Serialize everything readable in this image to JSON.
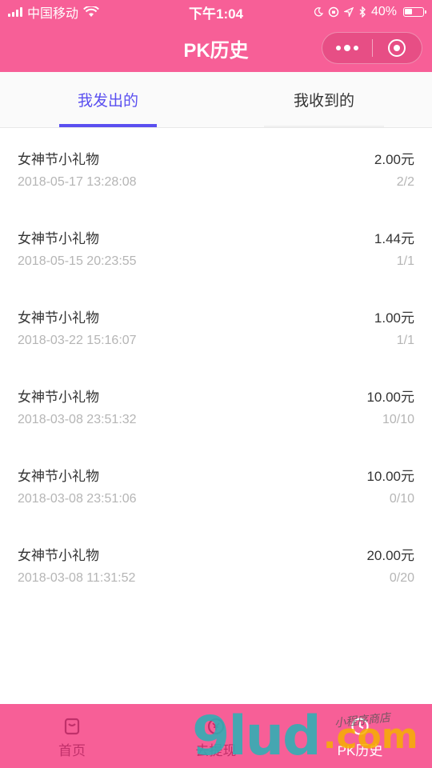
{
  "status_bar": {
    "carrier": "中国移动",
    "time": "下午1:04",
    "battery": "40%"
  },
  "nav": {
    "title": "PK历史"
  },
  "tabs": [
    {
      "label": "我发出的",
      "active": true
    },
    {
      "label": "我收到的",
      "active": false
    }
  ],
  "records": [
    {
      "name": "女神节小礼物",
      "amount": "2.00元",
      "time": "2018-05-17 13:28:08",
      "progress": "2/2"
    },
    {
      "name": "女神节小礼物",
      "amount": "1.44元",
      "time": "2018-05-15 20:23:55",
      "progress": "1/1"
    },
    {
      "name": "女神节小礼物",
      "amount": "1.00元",
      "time": "2018-03-22 15:16:07",
      "progress": "1/1"
    },
    {
      "name": "女神节小礼物",
      "amount": "10.00元",
      "time": "2018-03-08 23:51:32",
      "progress": "10/10"
    },
    {
      "name": "女神节小礼物",
      "amount": "10.00元",
      "time": "2018-03-08 23:51:06",
      "progress": "0/10"
    },
    {
      "name": "女神节小礼物",
      "amount": "20.00元",
      "time": "2018-03-08 11:31:52",
      "progress": "0/20"
    }
  ],
  "tab_bar": [
    {
      "label": "首页",
      "icon": "home-bag-icon",
      "active": false
    },
    {
      "label": "去提现",
      "icon": "withdraw-icon",
      "active": false
    },
    {
      "label": "PK历史",
      "icon": "clock-icon",
      "active": true
    }
  ],
  "watermark": {
    "text": "9lud",
    "dot": ".",
    "suffix": "com",
    "script": "小程序商店"
  },
  "colors": {
    "brand_pink": "#f75f97",
    "tab_active": "#5a4ff0",
    "subtext": "#b5b5b5"
  }
}
